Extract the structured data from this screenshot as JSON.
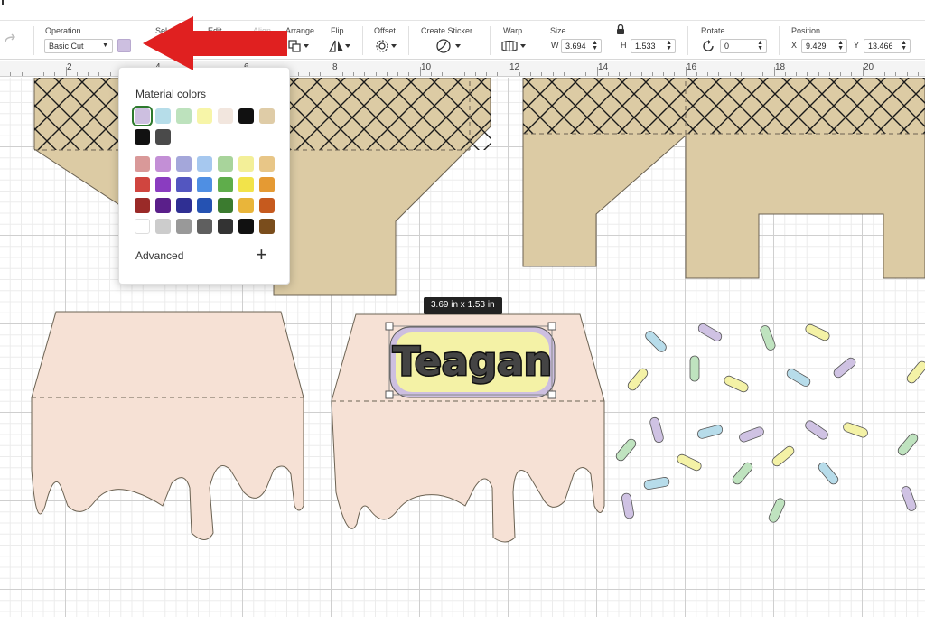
{
  "toolbar": {
    "operation_label": "Operation",
    "operation_value": "Basic Cut",
    "select_label": "Sel",
    "edit_label": "Edit",
    "align_label": "Align",
    "arrange_label": "Arrange",
    "flip_label": "Flip",
    "offset_label": "Offset",
    "create_sticker_label": "Create Sticker",
    "warp_label": "Warp",
    "size_label": "Size",
    "width_prefix": "W",
    "width_value": "3.694",
    "height_prefix": "H",
    "height_value": "1.533",
    "rotate_label": "Rotate",
    "rotate_value": "0",
    "position_label": "Position",
    "x_prefix": "X",
    "x_value": "9.429",
    "y_prefix": "Y",
    "y_value": "13.466",
    "current_color": "#cdbfe0"
  },
  "ruler": {
    "numbers": [
      "2",
      "4",
      "6",
      "8",
      "10",
      "12",
      "14",
      "16",
      "18",
      "20"
    ]
  },
  "popup": {
    "title": "Material colors",
    "material_colors_row1": [
      "#cdbfe0",
      "#b6dde9",
      "#bde2bd",
      "#f7f5a8",
      "#f2e6de",
      "#111111",
      "#dfcca7"
    ],
    "material_colors_row2": [
      "#111111",
      "#4a4a4a"
    ],
    "palette": [
      [
        "#d99999",
        "#c38fd6",
        "#a4a7da",
        "#a6c8ef",
        "#a8d49b",
        "#f3ef98",
        "#e8c687"
      ],
      [
        "#d0453f",
        "#8a3cc0",
        "#5356c0",
        "#4f8fe3",
        "#5fad4b",
        "#f2e34a",
        "#e59a33"
      ],
      [
        "#9a2a28",
        "#5a1f8a",
        "#2f2f93",
        "#2552b2",
        "#3b7b2f",
        "#e9b53a",
        "#c65a1e"
      ],
      [
        "#ffffff",
        "#cccccc",
        "#999999",
        "#5f5f5f",
        "#333333",
        "#111111",
        "#7a4d1c"
      ]
    ],
    "advanced_label": "Advanced",
    "plus_icon": "+"
  },
  "selection": {
    "dimension_tag": "3.69  in x 1.53  in",
    "text": "Teagan"
  },
  "colors": {
    "cone": "#dccba4",
    "drip": "#f6e1d5",
    "sprinkle_pink": "#cfc2e3",
    "sprinkle_blue": "#b7dcea",
    "sprinkle_green": "#bfe3bf",
    "sprinkle_yellow": "#f4f2a6",
    "arrow": "#e02020"
  }
}
